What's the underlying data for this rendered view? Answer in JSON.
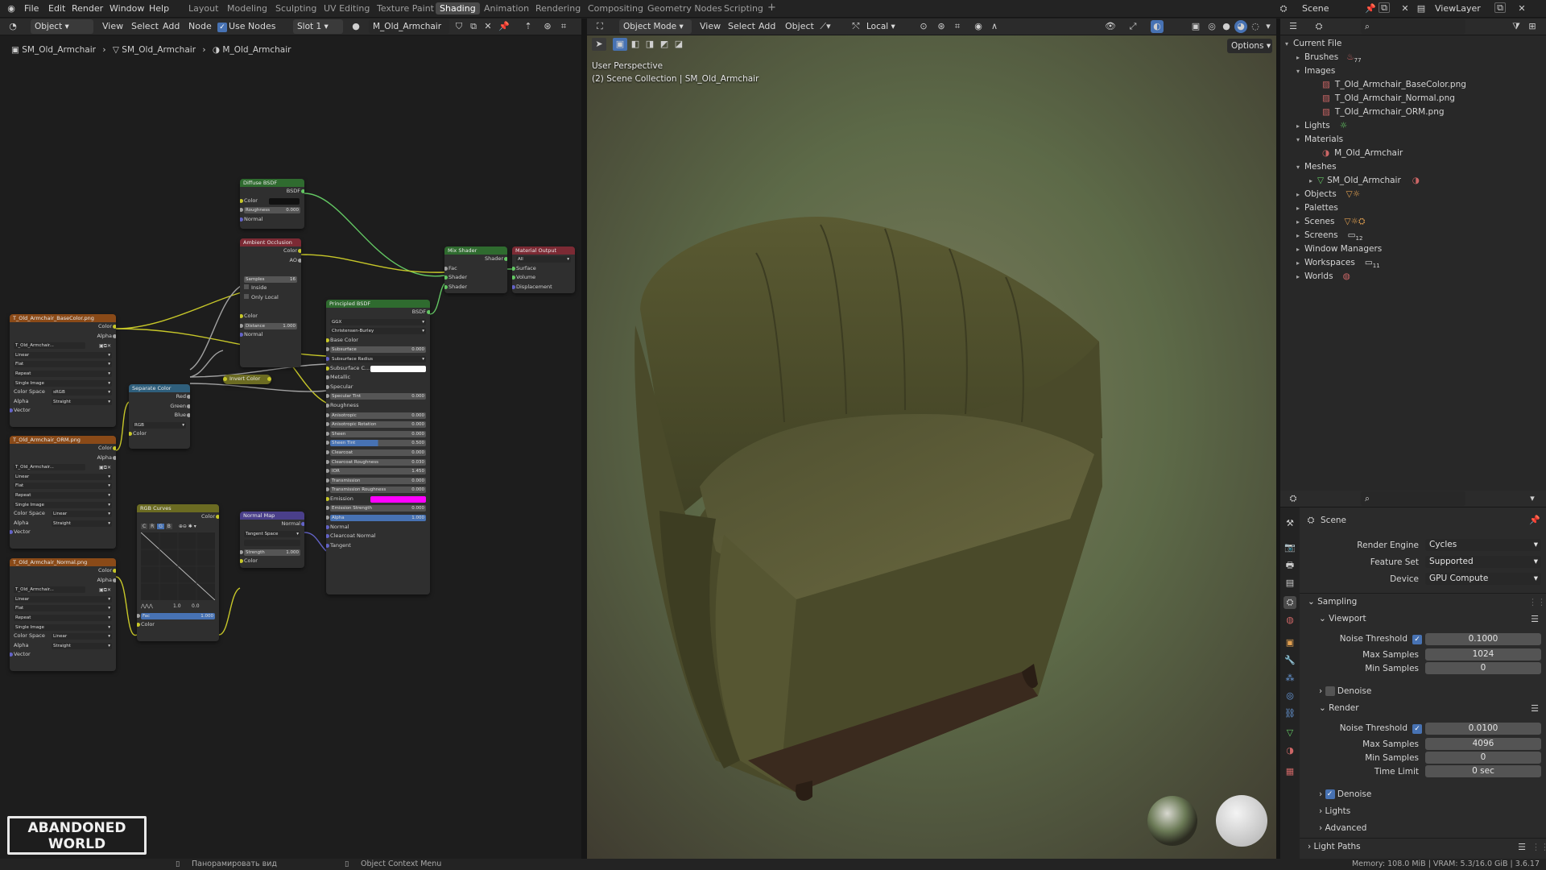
{
  "topbar": {
    "menus": [
      "File",
      "Edit",
      "Render",
      "Window",
      "Help"
    ],
    "workspaces": [
      "Layout",
      "Modeling",
      "Sculpting",
      "UV Editing",
      "Texture Paint",
      "Shading",
      "Animation",
      "Rendering",
      "Compositing",
      "Geometry Nodes",
      "Scripting"
    ],
    "active_workspace": "Shading",
    "add_workspace": "+",
    "scene": "Scene",
    "viewlayer": "ViewLayer"
  },
  "node_header": {
    "mode": "Object",
    "menus": [
      "View",
      "Select",
      "Add",
      "Node"
    ],
    "use_nodes": "Use Nodes",
    "slot": "Slot 1",
    "material": "M_Old_Armchair",
    "breadcrumb": [
      "SM_Old_Armchair",
      "SM_Old_Armchair",
      "M_Old_Armchair"
    ]
  },
  "nodes": {
    "diffuse": {
      "title": "Diffuse BSDF",
      "out": "BSDF",
      "color": "Color",
      "roughness": "Roughness",
      "roughness_val": "0.000",
      "normal": "Normal"
    },
    "ao": {
      "title": "Ambient Occlusion",
      "out_color": "Color",
      "out_ao": "AO",
      "samples": "Samples",
      "samples_val": "16",
      "inside": "Inside",
      "only_local": "Only Local",
      "color": "Color",
      "distance": "Distance",
      "distance_val": "1.000",
      "normal": "Normal"
    },
    "mix": {
      "title": "Mix Shader",
      "out": "Shader",
      "fac": "Fac",
      "shader1": "Shader",
      "shader2": "Shader"
    },
    "output": {
      "title": "Material Output",
      "target": "All",
      "surface": "Surface",
      "volume": "Volume",
      "displacement": "Displacement"
    },
    "principled": {
      "title": "Principled BSDF",
      "out": "BSDF",
      "distribution": "GGX",
      "sss_method": "Christensen-Burley",
      "base_color": "Base Color",
      "subsurface": "Subsurface",
      "subsurface_val": "0.000",
      "subsurface_radius": "Subsurface Radius",
      "subsurface_color": "Subsurface C...",
      "metallic": "Metallic",
      "specular": "Specular",
      "specular_tint": "Specular Tint",
      "specular_tint_val": "0.000",
      "roughness": "Roughness",
      "anisotropic": "Anisotropic",
      "anisotropic_val": "0.000",
      "anisotropic_rotation": "Anisotropic Rotation",
      "anisotropic_rotation_val": "0.000",
      "sheen": "Sheen",
      "sheen_val": "0.000",
      "sheen_tint": "Sheen Tint",
      "sheen_tint_val": "0.500",
      "clearcoat": "Clearcoat",
      "clearcoat_val": "0.000",
      "clearcoat_roughness": "Clearcoat Roughness",
      "clearcoat_roughness_val": "0.030",
      "ior": "IOR",
      "ior_val": "1.450",
      "transmission": "Transmission",
      "transmission_val": "0.000",
      "transmission_roughness": "Transmission Roughness",
      "transmission_roughness_val": "0.000",
      "emission": "Emission",
      "emission_strength": "Emission Strength",
      "emission_strength_val": "0.000",
      "alpha": "Alpha",
      "alpha_val": "1.000",
      "normal": "Normal",
      "clearcoat_normal": "Clearcoat Normal",
      "tangent": "Tangent"
    },
    "tex_basecolor": {
      "title": "T_Old_Armchair_BaseColor.png",
      "out_color": "Color",
      "out_alpha": "Alpha",
      "image": "T_Old_Armchair...",
      "interp": "Linear",
      "proj": "Flat",
      "ext": "Repeat",
      "src": "Single Image",
      "cs_label": "Color Space",
      "cs": "sRGB",
      "alpha_label": "Alpha",
      "alpha": "Straight",
      "vector": "Vector"
    },
    "tex_orm": {
      "title": "T_Old_Armchair_ORM.png",
      "out_color": "Color",
      "out_alpha": "Alpha",
      "image": "T_Old_Armchair...",
      "interp": "Linear",
      "proj": "Flat",
      "ext": "Repeat",
      "src": "Single Image",
      "cs_label": "Color Space",
      "cs": "Linear",
      "alpha_label": "Alpha",
      "alpha": "Straight",
      "vector": "Vector"
    },
    "tex_normal": {
      "title": "T_Old_Armchair_Normal.png",
      "out_color": "Color",
      "out_alpha": "Alpha",
      "image": "T_Old_Armchair...",
      "interp": "Linear",
      "proj": "Flat",
      "ext": "Repeat",
      "src": "Single Image",
      "cs_label": "Color Space",
      "cs": "Linear",
      "alpha_label": "Alpha",
      "alpha": "Straight",
      "vector": "Vector"
    },
    "separate": {
      "title": "Separate Color",
      "red": "Red",
      "green": "Green",
      "blue": "Blue",
      "mode": "RGB",
      "color": "Color"
    },
    "invert": {
      "title": "Invert Color"
    },
    "curves": {
      "title": "RGB Curves",
      "out": "Color",
      "channels": [
        "C",
        "R",
        "G",
        "B"
      ],
      "fac": "Fac",
      "fac_val": "1.000",
      "color": "Color",
      "x_val": "1.0",
      "y_val": "0.0"
    },
    "normalmap": {
      "title": "Normal Map",
      "out": "Normal",
      "space": "Tangent Space",
      "strength": "Strength",
      "strength_val": "1.000",
      "color": "Color"
    }
  },
  "viewport_header": {
    "mode": "Object Mode",
    "menus": [
      "View",
      "Select",
      "Add",
      "Object"
    ],
    "transform": "Local",
    "options": "Options"
  },
  "viewport": {
    "perspective": "User Perspective",
    "collection": "(2) Scene Collection | SM_Old_Armchair"
  },
  "outliner": {
    "root": "Current File",
    "items": [
      {
        "label": "Brushes",
        "badge": "77",
        "indent": 1,
        "tri": "▸"
      },
      {
        "label": "Images",
        "indent": 1,
        "tri": "▾"
      },
      {
        "label": "T_Old_Armchair_BaseColor.png",
        "indent": 2,
        "tri": ""
      },
      {
        "label": "T_Old_Armchair_Normal.png",
        "indent": 2,
        "tri": ""
      },
      {
        "label": "T_Old_Armchair_ORM.png",
        "indent": 2,
        "tri": ""
      },
      {
        "label": "Lights",
        "indent": 1,
        "tri": "▸"
      },
      {
        "label": "Materials",
        "indent": 1,
        "tri": "▾"
      },
      {
        "label": "M_Old_Armchair",
        "indent": 2,
        "tri": ""
      },
      {
        "label": "Meshes",
        "indent": 1,
        "tri": "▾"
      },
      {
        "label": "SM_Old_Armchair",
        "indent": 2,
        "tri": "▸"
      },
      {
        "label": "Objects",
        "indent": 1,
        "tri": "▸"
      },
      {
        "label": "Palettes",
        "indent": 1,
        "tri": "▸"
      },
      {
        "label": "Scenes",
        "indent": 1,
        "tri": "▸"
      },
      {
        "label": "Screens",
        "badge": "12",
        "indent": 1,
        "tri": "▸"
      },
      {
        "label": "Window Managers",
        "indent": 1,
        "tri": "▸"
      },
      {
        "label": "Workspaces",
        "badge": "11",
        "indent": 1,
        "tri": "▸"
      },
      {
        "label": "Worlds",
        "indent": 1,
        "tri": "▸"
      }
    ]
  },
  "properties": {
    "context": "Scene",
    "render_engine_label": "Render Engine",
    "render_engine": "Cycles",
    "feature_set_label": "Feature Set",
    "feature_set": "Supported",
    "device_label": "Device",
    "device": "GPU Compute",
    "sampling": "Sampling",
    "viewport": "Viewport",
    "noise_threshold_label": "Noise Threshold",
    "vp_noise_threshold": "0.1000",
    "max_samples_label": "Max Samples",
    "vp_max_samples": "1024",
    "min_samples_label": "Min Samples",
    "vp_min_samples": "0",
    "denoise": "Denoise",
    "render": "Render",
    "r_noise_threshold": "0.0100",
    "r_max_samples": "4096",
    "r_min_samples": "0",
    "time_limit_label": "Time Limit",
    "r_time_limit": "0 sec",
    "lights": "Lights",
    "advanced": "Advanced",
    "light_paths": "Light Paths"
  },
  "statusbar": {
    "pan": "Панорамировать вид",
    "context_menu": "Object Context Menu",
    "stats": "Memory: 108.0 MiB | VRAM: 5.3/16.0 GiB | 3.6.17"
  },
  "watermark": {
    "line1": "ABANDONED",
    "line2": "WORLD"
  },
  "colors": {
    "accent": "#4772b3",
    "shader_socket": "#63c763",
    "color_socket": "#c7c729",
    "float_socket": "#a1a1a1",
    "vector_socket": "#6363c7",
    "emission": "#ff00ff"
  }
}
